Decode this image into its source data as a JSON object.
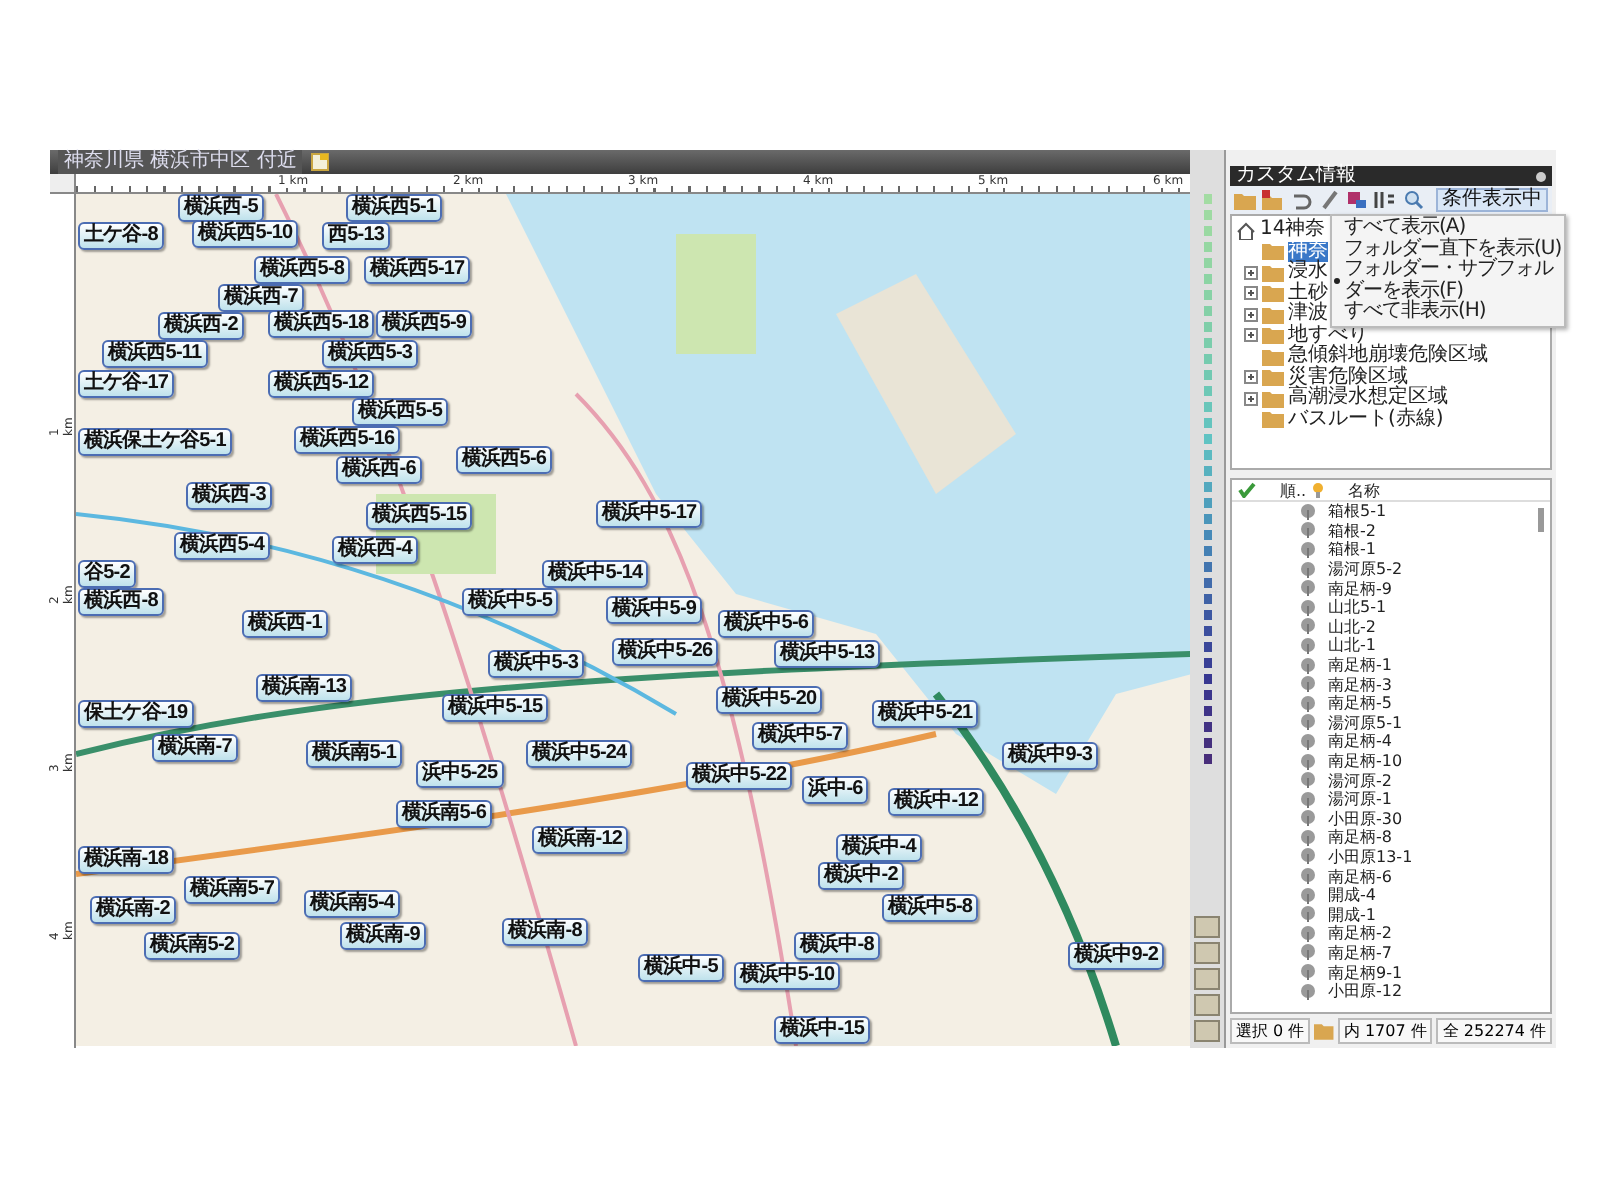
{
  "map_window": {
    "title": "神奈川県 横浜市中区 付近",
    "ruler_top": [
      "1 km",
      "2 km",
      "3 km",
      "4 km",
      "5 km",
      "6 km"
    ],
    "ruler_left": [
      "1 km",
      "2 km",
      "3 km",
      "4 km"
    ],
    "pins": [
      {
        "label": "横浜西-5"
      },
      {
        "label": "横浜西5-1"
      },
      {
        "label": "土ケ谷-8"
      },
      {
        "label": "横浜西5-10"
      },
      {
        "label": "西5-13"
      },
      {
        "label": "横浜西5-8"
      },
      {
        "label": "横浜西5-17"
      },
      {
        "label": "横浜西-7"
      },
      {
        "label": "横浜西-2"
      },
      {
        "label": "横浜西5-18"
      },
      {
        "label": "横浜西5-9"
      },
      {
        "label": "横浜西5-11"
      },
      {
        "label": "横浜西5-3"
      },
      {
        "label": "土ケ谷-17"
      },
      {
        "label": "横浜西5-12"
      },
      {
        "label": "横浜西5-5"
      },
      {
        "label": "横浜保土ケ谷5-1"
      },
      {
        "label": "横浜西5-16"
      },
      {
        "label": "横浜西-6"
      },
      {
        "label": "横浜西5-6"
      },
      {
        "label": "横浜西-3"
      },
      {
        "label": "横浜西5-15"
      },
      {
        "label": "横浜中5-17"
      },
      {
        "label": "横浜西5-4"
      },
      {
        "label": "横浜西-4"
      },
      {
        "label": "谷5-2"
      },
      {
        "label": "横浜中5-14"
      },
      {
        "label": "横浜西-8"
      },
      {
        "label": "横浜中5-5"
      },
      {
        "label": "横浜西-1"
      },
      {
        "label": "横浜中5-9"
      },
      {
        "label": "横浜中5-6"
      },
      {
        "label": "横浜中5-3"
      },
      {
        "label": "横浜中5-26"
      },
      {
        "label": "横浜中5-13"
      },
      {
        "label": "保土ケ谷-19"
      },
      {
        "label": "横浜南-13"
      },
      {
        "label": "横浜中5-15"
      },
      {
        "label": "横浜中5-20"
      },
      {
        "label": "横浜中5-21"
      },
      {
        "label": "横浜南-7"
      },
      {
        "label": "横浜南5-1"
      },
      {
        "label": "浜中5-25"
      },
      {
        "label": "横浜中5-24"
      },
      {
        "label": "横浜中5-22"
      },
      {
        "label": "横浜中5-7"
      },
      {
        "label": "浜中-6"
      },
      {
        "label": "横浜中-12"
      },
      {
        "label": "横浜中9-3"
      },
      {
        "label": "横浜南5-6"
      },
      {
        "label": "横浜南-18"
      },
      {
        "label": "横浜南-12"
      },
      {
        "label": "横浜中-4"
      },
      {
        "label": "横浜南-2"
      },
      {
        "label": "横浜南5-7"
      },
      {
        "label": "横浜南5-4"
      },
      {
        "label": "横浜中-2"
      },
      {
        "label": "横浜中5-8"
      },
      {
        "label": "横浜南5-2"
      },
      {
        "label": "横浜南-9"
      },
      {
        "label": "横浜南-8"
      },
      {
        "label": "横浜中-5"
      },
      {
        "label": "横浜中5-10"
      },
      {
        "label": "横浜中-8"
      },
      {
        "label": "横浜中9-2"
      },
      {
        "label": "横浜中-15"
      }
    ]
  },
  "custom_panel": {
    "title": "カスタム情報",
    "filter_button": "条件表示中",
    "tree": [
      {
        "label": "14神奈",
        "expanded": true,
        "children": [
          {
            "label": "神奈",
            "selected": true,
            "expandable": false
          },
          {
            "label": "浸水",
            "selected": false,
            "expandable": true
          },
          {
            "label": "土砂",
            "selected": false,
            "expandable": true
          },
          {
            "label": "津波",
            "selected": false,
            "expandable": true
          },
          {
            "label": "地すべり",
            "selected": false,
            "expandable": true
          },
          {
            "label": "急傾斜地崩壊危険区域",
            "selected": false,
            "expandable": false
          },
          {
            "label": "災害危険区域",
            "selected": false,
            "expandable": true
          },
          {
            "label": "高潮浸水想定区域",
            "selected": false,
            "expandable": true
          },
          {
            "label": "バスルート(赤線)",
            "selected": false,
            "expandable": false
          }
        ]
      }
    ],
    "context_menu": [
      {
        "label": "すべて表示(A)",
        "checked": false
      },
      {
        "label": "フォルダー直下を表示(U)",
        "checked": false
      },
      {
        "label": "フォルダー・サブフォルダーを表示(F)",
        "checked": true
      },
      {
        "label": "すべて非表示(H)",
        "checked": false
      }
    ],
    "list": {
      "columns": [
        "順..",
        "名称"
      ],
      "rows": [
        "箱根5-1",
        "箱根-2",
        "箱根-1",
        "湯河原5-2",
        "南足柄-9",
        "山北5-1",
        "山北-2",
        "山北-1",
        "南足柄-1",
        "南足柄-3",
        "南足柄-5",
        "湯河原5-1",
        "南足柄-4",
        "南足柄-10",
        "湯河原-2",
        "湯河原-1",
        "小田原-30",
        "南足柄-8",
        "小田原13-1",
        "南足柄-6",
        "開成-4",
        "開成-1",
        "南足柄-2",
        "南足柄-7",
        "南足柄9-1",
        "小田原-12"
      ]
    },
    "status": {
      "selected": "選択 0 件",
      "in_folder": "内 1707 件",
      "total": "全 252274 件"
    }
  }
}
